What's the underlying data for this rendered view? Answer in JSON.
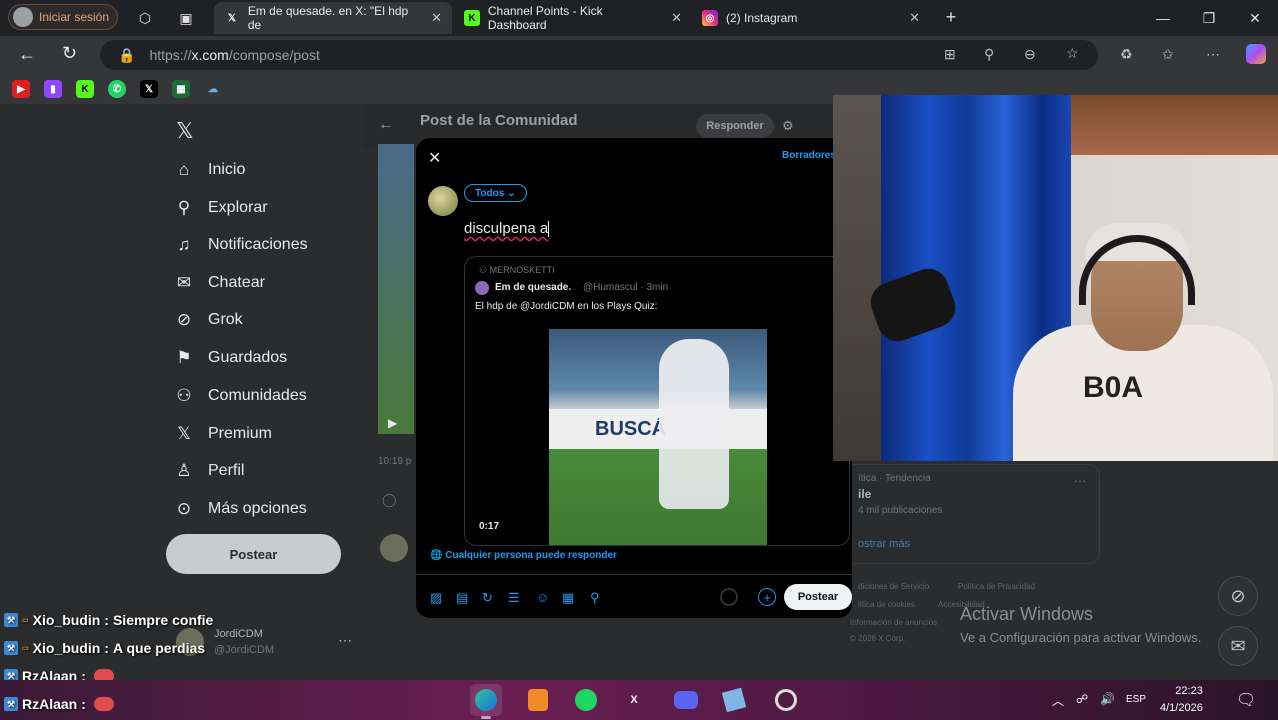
{
  "browser": {
    "profile_label": "Iniciar sesión",
    "tabs": [
      {
        "title": "Em de quesade. en X: \"El hdp de",
        "favicon": "X"
      },
      {
        "title": "Channel Points - Kick Dashboard",
        "favicon": "K"
      },
      {
        "title": "(2) Instagram",
        "favicon": "IG"
      }
    ],
    "url_prefix": "https://",
    "url_domain": "x.com",
    "url_path": "/compose/post"
  },
  "sidebar": {
    "items": [
      {
        "label": "Inicio",
        "icon": "home-icon",
        "glyph": "⌂"
      },
      {
        "label": "Explorar",
        "icon": "search-icon",
        "glyph": "⚲"
      },
      {
        "label": "Notificaciones",
        "icon": "bell-icon",
        "glyph": "🔔"
      },
      {
        "label": "Chatear",
        "icon": "mail-icon",
        "glyph": "✉"
      },
      {
        "label": "Grok",
        "icon": "grok-icon",
        "glyph": "⊘"
      },
      {
        "label": "Guardados",
        "icon": "bookmark-icon",
        "glyph": "⚑"
      },
      {
        "label": "Comunidades",
        "icon": "people-icon",
        "glyph": "👥"
      },
      {
        "label": "Premium",
        "icon": "x-icon",
        "glyph": "𝕏"
      },
      {
        "label": "Perfil",
        "icon": "profile-icon",
        "glyph": "♙"
      },
      {
        "label": "Más opciones",
        "icon": "more-icon",
        "glyph": "⋯"
      }
    ],
    "post_button": "Postear",
    "account_name": "JordiCDM",
    "account_handle": "@JordiCDM"
  },
  "main": {
    "header_title": "Post de la Comunidad",
    "reply_button": "Responder",
    "timestamp": "10:19 p"
  },
  "compose": {
    "drafts": "Borradores",
    "audience": "Todos",
    "text": "disculpena a",
    "quote": {
      "context": "MERNOSKETTI",
      "author": "Em de quesade.",
      "handle": "@Humascul · 3min",
      "text": "El hdp de @JordiCDM  en los Plays Quiz:",
      "board_text": "BUSCÁ",
      "duration": "0:17"
    },
    "reply_setting": "Cualquier persona puede responder",
    "post_button": "Postear"
  },
  "right": {
    "trend_context": "ítica · Tendencia",
    "trend_name": "ile",
    "trend_count": "4 mil publicaciones",
    "show_more": "ostrar más",
    "footer": [
      "diciones de Servicio",
      "Política de Privacidad",
      "lítica de cookies",
      "Accesibilidad",
      "Información de anuncios",
      "© 2026 X Corp."
    ]
  },
  "watermark": {
    "line1": "Activar Windows",
    "line2": "Ve a Configuración para activar Windows."
  },
  "chat": [
    {
      "user": "Xio_budin",
      "message": "Siempre confie"
    },
    {
      "user": "Xio_budin",
      "message": "A que perdias"
    },
    {
      "user": "RzAlaan",
      "message": ""
    },
    {
      "user": "RzAlaan",
      "message": ""
    }
  ],
  "taskbar": {
    "lang": "ESP",
    "time": "22:23",
    "date": "4/1/2026"
  },
  "colors": {
    "accent": "#1d9bf0",
    "background": "#2a2c2e"
  }
}
